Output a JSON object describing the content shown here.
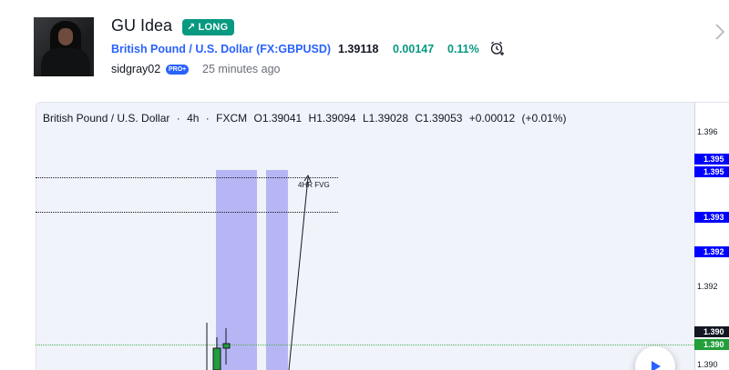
{
  "idea": {
    "title": "GU Idea",
    "direction_badge": "LONG",
    "direction_icon": "arrow-up-right-icon"
  },
  "symbol": {
    "name": "British Pound / U.S. Dollar",
    "paren_open": "(",
    "ticker": "FX:GBPUSD",
    "paren_close": ")",
    "price": "1.39118",
    "change": "0.00147",
    "change_pct": "0.11%"
  },
  "author": {
    "username": "sidgray02",
    "badge": "PRO+",
    "posted": "25 minutes ago"
  },
  "chart": {
    "legend": {
      "name": "British Pound / U.S. Dollar",
      "sep1": "·",
      "interval": "4h",
      "sep2": "·",
      "source": "FXCM",
      "open_label": "O",
      "open": "1.39041",
      "high_label": "H",
      "high": "1.39094",
      "low_label": "L",
      "low": "1.39028",
      "close_label": "C",
      "close": "1.39053",
      "change": "+0.00012",
      "change_pct": "(+0.01%)"
    },
    "annotation": "4HR FVG",
    "axis_ticks": [
      "1.396",
      "1.392",
      "1.390"
    ],
    "price_tags": [
      {
        "value": "1.395",
        "style": "blue"
      },
      {
        "value": "1.395",
        "style": "blue"
      },
      {
        "value": "1.393",
        "style": "blue"
      },
      {
        "value": "1.392",
        "style": "blue"
      },
      {
        "value": "1.390",
        "style": "navy"
      },
      {
        "value": "1.390",
        "style": "green"
      }
    ],
    "colors": {
      "background": "#f0f3fa",
      "box": "#b7b6f5",
      "up_candle": "#229e3a",
      "accent": "#2962ff",
      "long": "#089981"
    }
  }
}
